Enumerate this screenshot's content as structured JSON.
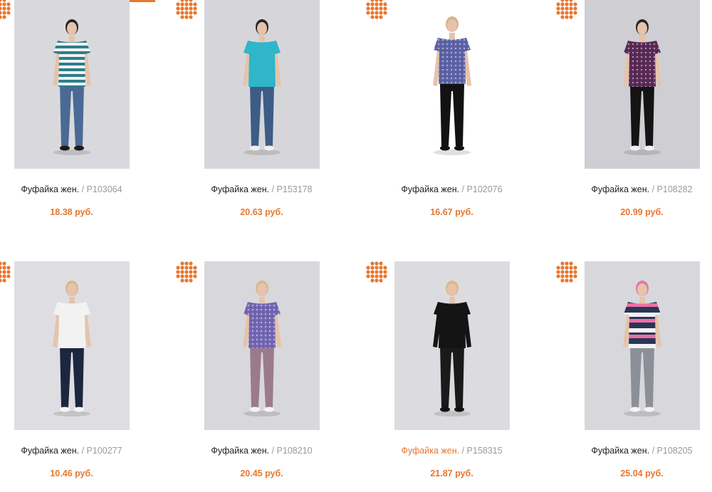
{
  "accent_color": "#e8772e",
  "badge_icon": "dotted-circle-brand-icon",
  "products": [
    {
      "name": "Фуфайка жен.",
      "sku": "P103064",
      "price": "18.38 руб.",
      "bg": "#d9d9dd",
      "top": "#9fc9cf",
      "pattern": "stripes",
      "bottom": "#4a6a95",
      "hair": "#2a2522",
      "shoes": "#1a1a1a",
      "highlight": false
    },
    {
      "name": "Фуфайка жен.",
      "sku": "P153178",
      "price": "20.63 руб.",
      "bg": "#d6d6da",
      "top": "#2fb6c8",
      "pattern": "plain",
      "bottom": "#3d5c86",
      "hair": "#2a2522",
      "shoes": "#efefef",
      "highlight": false
    },
    {
      "name": "Фуфайка жен.",
      "sku": "P102076",
      "price": "16.67 руб.",
      "bg": "#ffffff",
      "top": "#5d63a8",
      "pattern": "dots",
      "bottom": "#121212",
      "hair": "#d2b48c",
      "shoes": "#111111",
      "highlight": false
    },
    {
      "name": "Фуфайка жен.",
      "sku": "P108282",
      "price": "20.99 руб.",
      "bg": "#cfcfd3",
      "top": "#5a2b57",
      "pattern": "dots",
      "bottom": "#141414",
      "hair": "#2a2522",
      "shoes": "#f0f0f0",
      "highlight": false
    },
    {
      "name": "Фуфайка жен.",
      "sku": "P100277",
      "price": "10.46 руб.",
      "bg": "#dedee2",
      "top": "#f2f2f2",
      "pattern": "plain",
      "bottom": "#1d2640",
      "hair": "#d9b98a",
      "shoes": "#f4f4f4",
      "highlight": false
    },
    {
      "name": "Фуфайка жен.",
      "sku": "P108210",
      "price": "20.45 руб.",
      "bg": "#d8d8dc",
      "top": "#7467b4",
      "pattern": "dots",
      "bottom": "#9c7a8e",
      "hair": "#d9b98a",
      "shoes": "#f4f4f4",
      "highlight": false
    },
    {
      "name": "Фуфайка жен.",
      "sku": "P158315",
      "price": "21.87 руб.",
      "bg": "#dcdce0",
      "top": "#141414",
      "pattern": "longsleeve",
      "bottom": "#1a1a1a",
      "hair": "#d9b98a",
      "shoes": "#111111",
      "highlight": true
    },
    {
      "name": "Фуфайка жен.",
      "sku": "P108205",
      "price": "25.04 руб.",
      "bg": "#d8d8dc",
      "top": "#2a3556",
      "pattern": "wide-stripes",
      "bottom": "#8c8f97",
      "hair": "#e07aa3",
      "shoes": "#f4f4f4",
      "highlight": false
    }
  ]
}
